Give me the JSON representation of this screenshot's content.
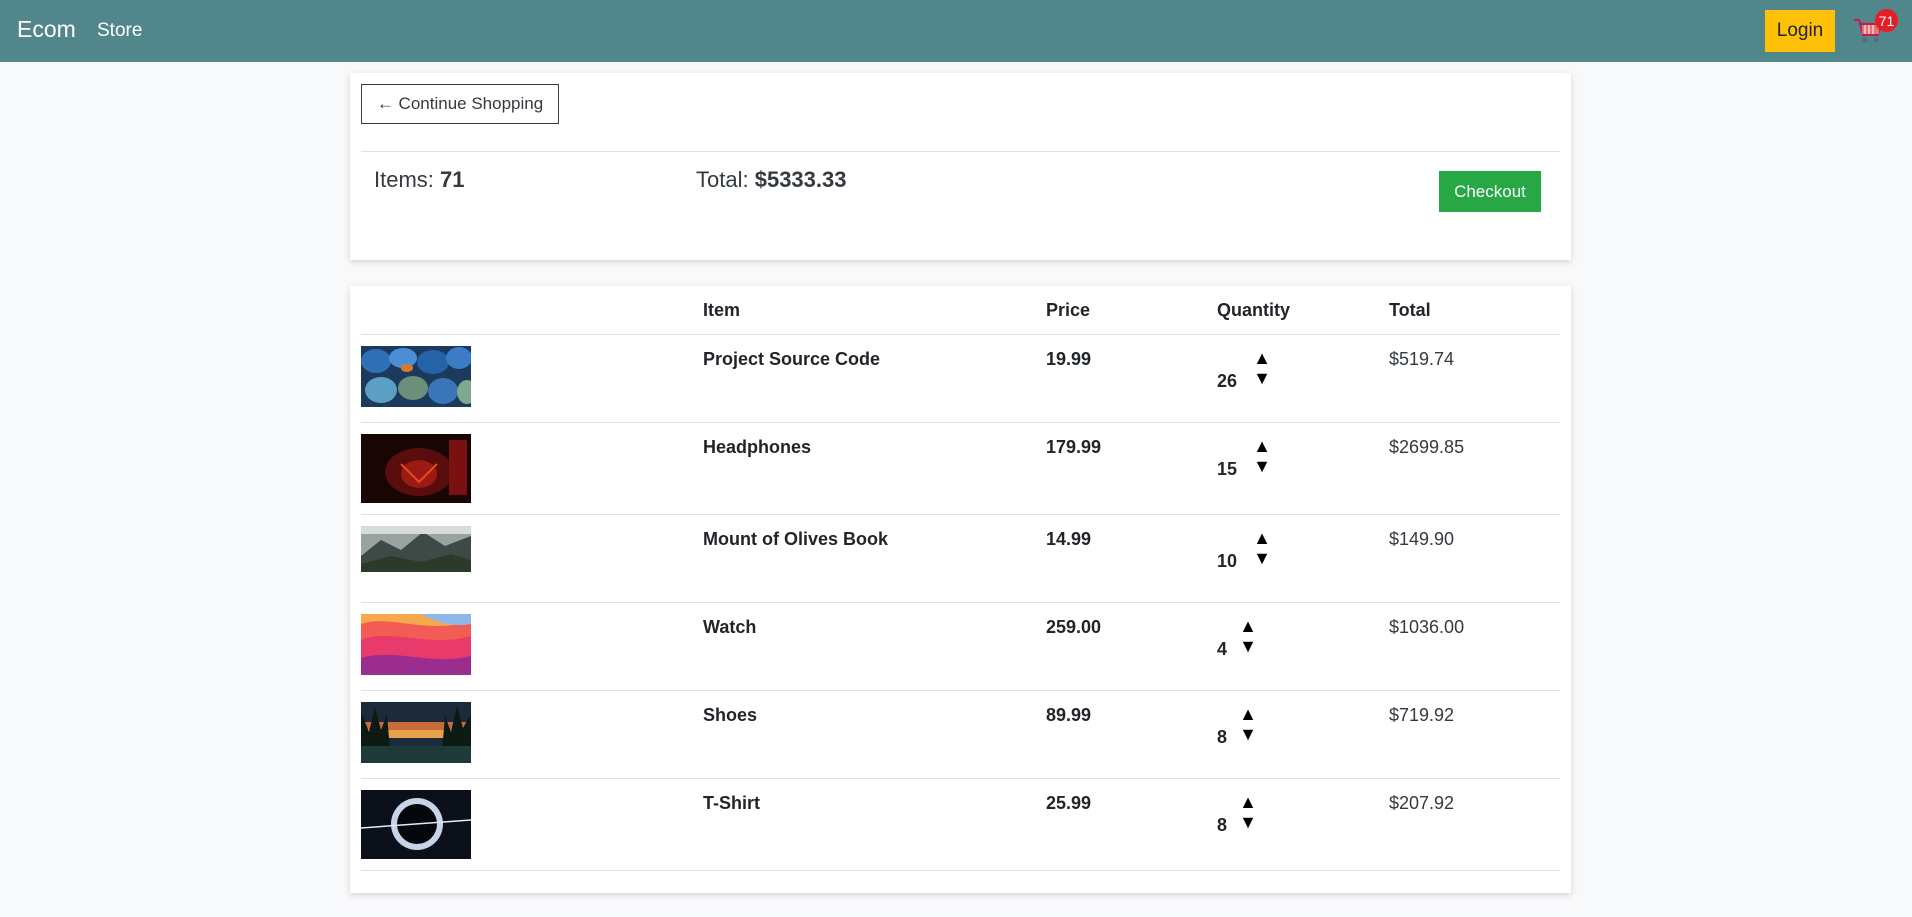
{
  "navbar": {
    "brand": "Ecom",
    "store_link": "Store",
    "login_label": "Login",
    "cart_count": "71",
    "cart_icon": "shopping-cart-icon"
  },
  "summary": {
    "continue_label": "← Continue Shopping",
    "items_label": "Items:",
    "items_value": "71",
    "total_label": "Total:",
    "total_value": "$5333.33",
    "checkout_label": "Checkout"
  },
  "table": {
    "headers": [
      "Item",
      "Price",
      "Quantity",
      "Total"
    ],
    "rows": [
      {
        "name": "Project Source Code",
        "price": "19.99",
        "qty": "26",
        "total": "$519.74",
        "image": "blue-stones-image"
      },
      {
        "name": "Headphones",
        "price": "179.99",
        "qty": "15",
        "total": "$2699.85",
        "image": "red-demon-image"
      },
      {
        "name": "Mount of Olives Book",
        "price": "14.99",
        "qty": "10",
        "total": "$149.90",
        "image": "mountain-landscape-image"
      },
      {
        "name": "Watch",
        "price": "259.00",
        "qty": "4",
        "total": "$1036.00",
        "image": "pink-waves-image"
      },
      {
        "name": "Shoes",
        "price": "89.99",
        "qty": "8",
        "total": "$719.92",
        "image": "forest-sunset-image"
      },
      {
        "name": "T-Shirt",
        "price": "25.99",
        "qty": "8",
        "total": "$207.92",
        "image": "eclipse-image"
      }
    ],
    "up_arrow": "▲",
    "down_arrow": "▼"
  },
  "colors": {
    "navbar": "#51878b",
    "login": "#ffc107",
    "checkout": "#28a745",
    "badge": "#e41e26"
  }
}
